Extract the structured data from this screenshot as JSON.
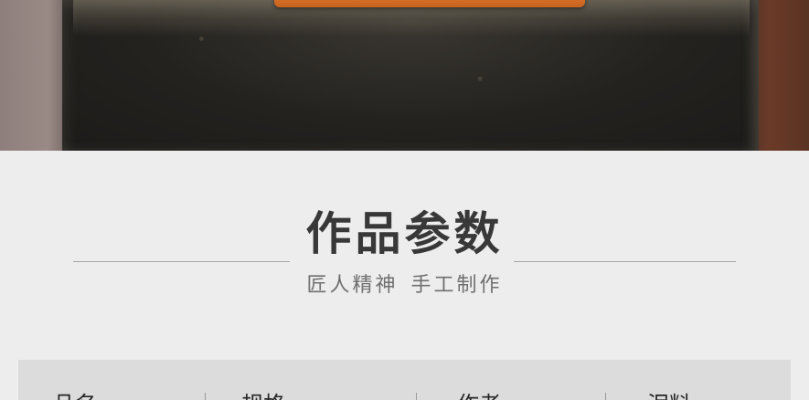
{
  "section": {
    "title": "作品参数",
    "subtitle_left": "匠人精神",
    "subtitle_right": "手工制作"
  },
  "spec_table": {
    "headers": [
      "品名",
      "规格",
      "作者",
      "泥料"
    ]
  },
  "colors": {
    "background": "#ededed",
    "title": "#383838",
    "subtitle": "#6f6f6f",
    "rule": "#a6a6a6",
    "table_bg": "#dcdcdc"
  }
}
